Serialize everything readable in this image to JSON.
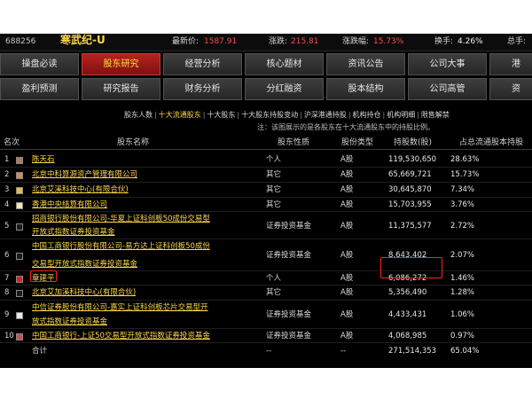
{
  "header": {
    "code": "688256",
    "name": "寒武纪-U",
    "latest_label": "最新价:",
    "latest_value": "1587.91",
    "change_label": "涨跌:",
    "change_value": "215.81",
    "change_pct_label": "涨跌幅:",
    "change_pct_value": "15.73%",
    "turnover_label": "换手:",
    "turnover_value": "4.26%",
    "total_label": "总手:"
  },
  "nav_row1": [
    "操盘必读",
    "股东研究",
    "经营分析",
    "核心题材",
    "资讯公告",
    "公司大事",
    "港"
  ],
  "nav_row2": [
    "盈利预测",
    "研究报告",
    "财务分析",
    "分红融资",
    "股本结构",
    "公司高管",
    "资"
  ],
  "subtabs": [
    "股东人数",
    "十大流通股东",
    "十大股东",
    "十大股东持股变动",
    "沪深港通持股",
    "机构持仓",
    "机构明细",
    "限售解禁"
  ],
  "note": "注：该图展示的是各股东在十大流通股东中的持股比例。",
  "columns": [
    "名次",
    "股东名称",
    "股东性质",
    "股份类型",
    "持股数(股)",
    "占总流通股本持股"
  ],
  "rows": [
    {
      "rank": "1",
      "name1": "陈天石",
      "name2": "",
      "nature": "个人",
      "type": "A股",
      "holding": "119,530,650",
      "pct": "28.63%",
      "color": "#b07a5a"
    },
    {
      "rank": "2",
      "name1": "北京中科算源资产管理有限公司",
      "name2": "",
      "nature": "其它",
      "type": "A股",
      "holding": "65,669,721",
      "pct": "15.73%",
      "color": "#d18a5c"
    },
    {
      "rank": "3",
      "name1": "北京艾溪科技中心(有限合伙)",
      "name2": "",
      "nature": "其它",
      "type": "A股",
      "holding": "30,645,870",
      "pct": "7.34%",
      "color": "#e0c040"
    },
    {
      "rank": "4",
      "name1": "香港中央结算有限公司",
      "name2": "",
      "nature": "其它",
      "type": "A股",
      "holding": "15,703,955",
      "pct": "3.76%",
      "color": "#f2e8b0"
    },
    {
      "rank": "5",
      "name1": "招商银行股份有限公司-华夏上证科创板50成份交易型",
      "name2": "开放式指数证券投资基金",
      "nature": "证券投资基金",
      "type": "A股",
      "holding": "11,375,577",
      "pct": "2.72%",
      "color": "#1a1a1a"
    },
    {
      "rank": "6",
      "name1": "中国工商银行股份有限公司-易方达上证科创板50成份",
      "name2": "交易型开放式指数证券投资基金",
      "nature": "证券投资基金",
      "type": "A股",
      "holding": "8,643,402",
      "pct": "2.07%",
      "color": "#1a1a1a"
    },
    {
      "rank": "7",
      "name1": "章建平",
      "name2": "",
      "nature": "个人",
      "type": "A股",
      "holding": "6,086,272",
      "pct": "1.46%",
      "color": "#e02020"
    },
    {
      "rank": "8",
      "name1": "北京艾加溪科技中心(有限合伙)",
      "name2": "",
      "nature": "其它",
      "type": "A股",
      "holding": "5,356,490",
      "pct": "1.28%",
      "color": "#1a1a1a"
    },
    {
      "rank": "9",
      "name1": "中信证券股份有限公司-嘉实上证科创板芯片交易型开",
      "name2": "放式指数证券投资基金",
      "nature": "证券投资基金",
      "type": "A股",
      "holding": "4,433,431",
      "pct": "1.06%",
      "color": "#e8e8e8"
    },
    {
      "rank": "10",
      "name1": "中国工商银行-上证50交易型开放式指数证券投资基金",
      "name2": "",
      "nature": "证券投资基金",
      "type": "A股",
      "holding": "4,068,985",
      "pct": "0.97%",
      "color": "#d05050"
    }
  ],
  "total": {
    "label": "合计",
    "nature": "--",
    "type": "--",
    "holding": "271,514,353",
    "pct": "65.04%"
  }
}
